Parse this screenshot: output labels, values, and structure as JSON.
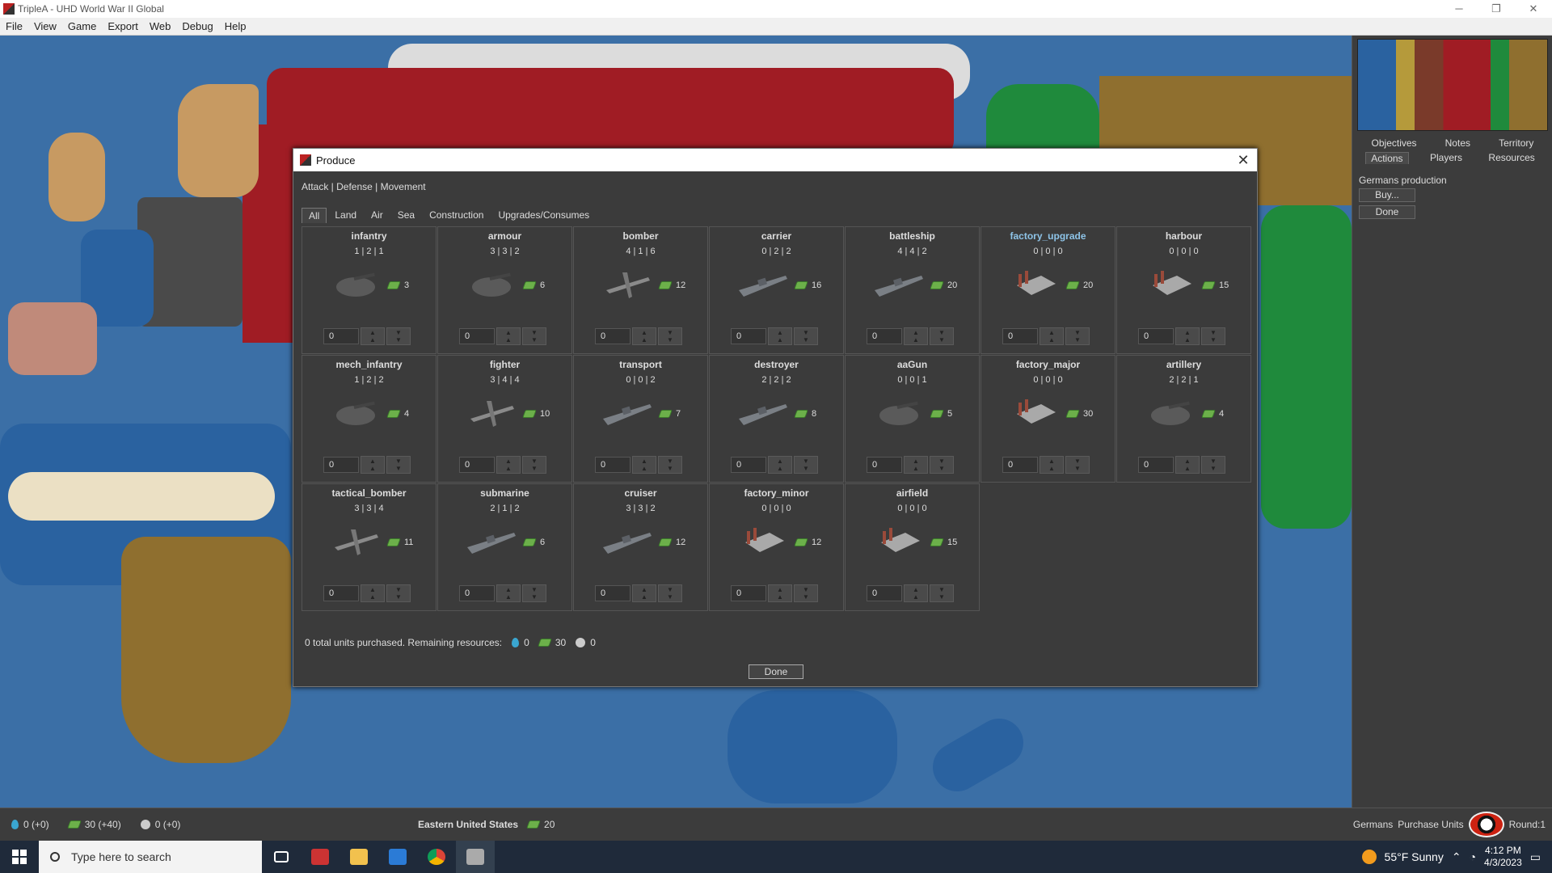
{
  "window": {
    "title": "TripleA - UHD World War II Global",
    "controls": [
      "─",
      "❐",
      "✕"
    ]
  },
  "menu": [
    "File",
    "View",
    "Game",
    "Export",
    "Web",
    "Debug",
    "Help"
  ],
  "sidebar": {
    "tabs_row1": [
      "Objectives",
      "Notes",
      "Territory"
    ],
    "tabs_row2": [
      "Actions",
      "Players",
      "Resources"
    ],
    "active_tab": "Actions",
    "production_label": "Germans production",
    "buy_label": "Buy...",
    "done_label": "Done"
  },
  "dialog": {
    "title": "Produce",
    "stats_header": "Attack | Defense | Movement",
    "tabs": [
      "All",
      "Land",
      "Air",
      "Sea",
      "Construction",
      "Upgrades/Consumes"
    ],
    "active_tab": "All",
    "units": [
      {
        "name": "infantry",
        "stats": "1 | 2 | 1",
        "cost": "3",
        "qty": "0"
      },
      {
        "name": "armour",
        "stats": "3 | 3 | 2",
        "cost": "6",
        "qty": "0"
      },
      {
        "name": "bomber",
        "stats": "4 | 1 | 6",
        "cost": "12",
        "qty": "0"
      },
      {
        "name": "carrier",
        "stats": "0 | 2 | 2",
        "cost": "16",
        "qty": "0"
      },
      {
        "name": "battleship",
        "stats": "4 | 4 | 2",
        "cost": "20",
        "qty": "0"
      },
      {
        "name": "factory_upgrade",
        "stats": "0 | 0 | 0",
        "cost": "20",
        "qty": "0",
        "highlight": true
      },
      {
        "name": "harbour",
        "stats": "0 | 0 | 0",
        "cost": "15",
        "qty": "0"
      },
      {
        "name": "mech_infantry",
        "stats": "1 | 2 | 2",
        "cost": "4",
        "qty": "0"
      },
      {
        "name": "fighter",
        "stats": "3 | 4 | 4",
        "cost": "10",
        "qty": "0"
      },
      {
        "name": "transport",
        "stats": "0 | 0 | 2",
        "cost": "7",
        "qty": "0"
      },
      {
        "name": "destroyer",
        "stats": "2 | 2 | 2",
        "cost": "8",
        "qty": "0"
      },
      {
        "name": "aaGun",
        "stats": "0 | 0 | 1",
        "cost": "5",
        "qty": "0"
      },
      {
        "name": "factory_major",
        "stats": "0 | 0 | 0",
        "cost": "30",
        "qty": "0"
      },
      {
        "name": "artillery",
        "stats": "2 | 2 | 1",
        "cost": "4",
        "qty": "0"
      },
      {
        "name": "tactical_bomber",
        "stats": "3 | 3 | 4",
        "cost": "11",
        "qty": "0"
      },
      {
        "name": "submarine",
        "stats": "2 | 1 | 2",
        "cost": "6",
        "qty": "0"
      },
      {
        "name": "cruiser",
        "stats": "3 | 3 | 2",
        "cost": "12",
        "qty": "0"
      },
      {
        "name": "factory_minor",
        "stats": "0 | 0 | 0",
        "cost": "12",
        "qty": "0"
      },
      {
        "name": "airfield",
        "stats": "0 | 0 | 0",
        "cost": "15",
        "qty": "0"
      }
    ],
    "footer_text": "0 total units purchased. Remaining resources:",
    "res_fuel": "0",
    "res_pus": "30",
    "res_tech": "0",
    "done_label": "Done"
  },
  "statusbar": {
    "fuel": "0 (+0)",
    "pus": "30 (+40)",
    "tech": "0 (+0)",
    "territory": "Eastern United States",
    "territory_value": "20",
    "player": "Germans",
    "step": "Purchase Units",
    "round": "Round:1"
  },
  "taskbar": {
    "search_placeholder": "Type here to search",
    "weather": "55°F  Sunny",
    "time": "4:12 PM",
    "date": "4/3/2023"
  },
  "colors": {
    "germany": "#4a4a4a",
    "ussr": "#a01c24",
    "uk": "#c79a62",
    "usa": "#1f8a3c",
    "sea": "#3b6fa6",
    "accent_highlight": "#8ec4e8"
  }
}
